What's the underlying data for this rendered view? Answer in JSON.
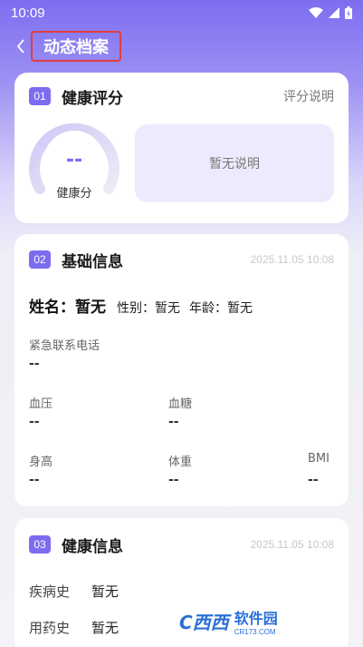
{
  "status_bar": {
    "time": "10:09"
  },
  "header": {
    "title": "动态档案"
  },
  "health_score": {
    "number": "01",
    "title": "健康评分",
    "link": "评分说明",
    "score": "--",
    "score_label": "健康分",
    "description": "暂无说明"
  },
  "basic_info": {
    "number": "02",
    "title": "基础信息",
    "date": "2025.11.05 10:08",
    "name_label": "姓名：",
    "name_value": "暂无",
    "gender_label": "性别：",
    "gender_value": "暂无",
    "age_label": "年龄：",
    "age_value": "暂无",
    "emergency_label": "紧急联系电话",
    "emergency_value": "--",
    "bp_label": "血压",
    "bp_value": "--",
    "sugar_label": "血糖",
    "sugar_value": "--",
    "height_label": "身高",
    "height_value": "--",
    "weight_label": "体重",
    "weight_value": "--",
    "bmi_label": "BMI",
    "bmi_value": "--"
  },
  "health_info": {
    "number": "03",
    "title": "健康信息",
    "date": "2025.11.05 10:08",
    "rows": [
      {
        "label": "疾病史",
        "value": "暂无"
      },
      {
        "label": "用药史",
        "value": "暂无"
      }
    ]
  },
  "watermark": {
    "logo": "C西西",
    "text": "软件园",
    "sub": "CR173.COM"
  },
  "colors": {
    "accent": "#7b6cf0",
    "highlight_border": "#e23d3d"
  }
}
